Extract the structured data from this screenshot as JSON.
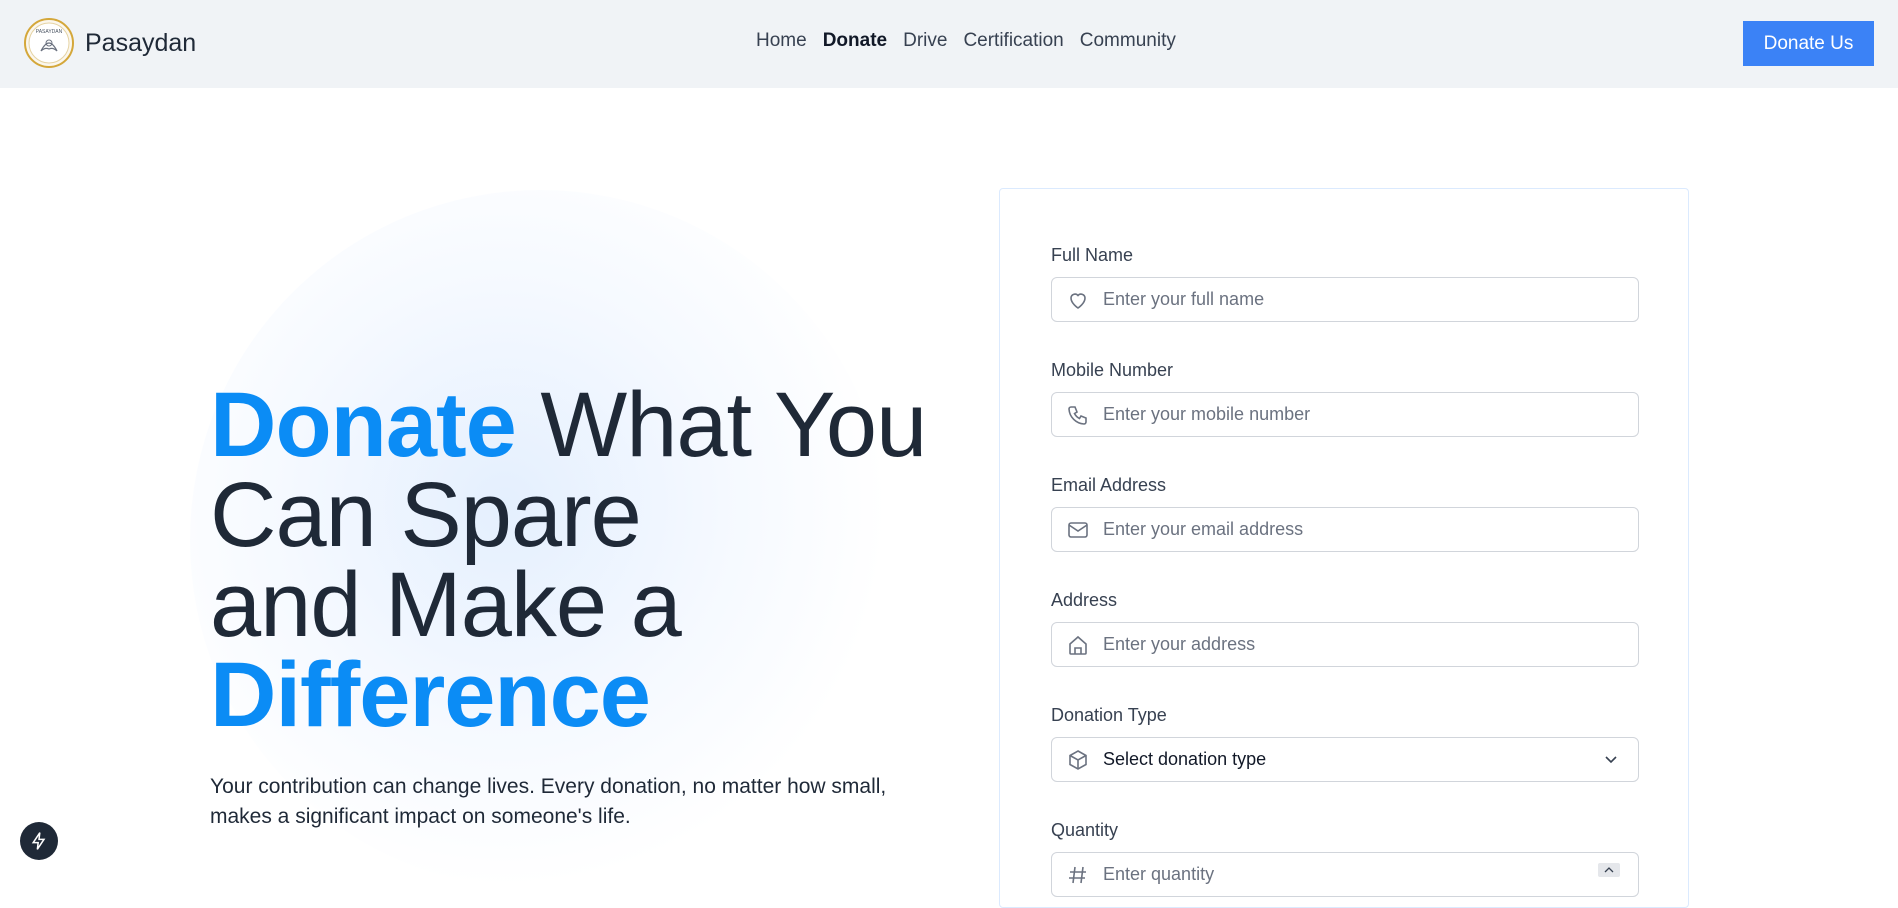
{
  "header": {
    "brand_name": "Pasaydan",
    "logo_text": "PASAYDAN",
    "nav": [
      "Home",
      "Donate",
      "Drive",
      "Certification",
      "Community"
    ],
    "active_nav": "Donate",
    "cta_label": "Donate Us"
  },
  "hero": {
    "title_accent_1": "Donate",
    "title_rest_1": " What You",
    "title_line_2": "Can Spare",
    "title_line_3": "and Make a",
    "title_accent_2": "Difference",
    "subtitle": "Your contribution can change lives. Every donation, no matter how small, makes a significant impact on someone's life."
  },
  "form": {
    "full_name": {
      "label": "Full Name",
      "placeholder": "Enter your full name",
      "icon": "heart-icon"
    },
    "mobile": {
      "label": "Mobile Number",
      "placeholder": "Enter your mobile number",
      "icon": "phone-icon"
    },
    "email": {
      "label": "Email Address",
      "placeholder": "Enter your email address",
      "icon": "mail-icon"
    },
    "address": {
      "label": "Address",
      "placeholder": "Enter your address",
      "icon": "home-icon"
    },
    "donation_type": {
      "label": "Donation Type",
      "value": "Select donation type",
      "icon": "package-icon"
    },
    "quantity": {
      "label": "Quantity",
      "placeholder": "Enter quantity",
      "icon": "hash-icon"
    }
  },
  "colors": {
    "accent": "#0b8cf5",
    "button": "#3b82f6",
    "header_bg": "#f0f3f6"
  }
}
